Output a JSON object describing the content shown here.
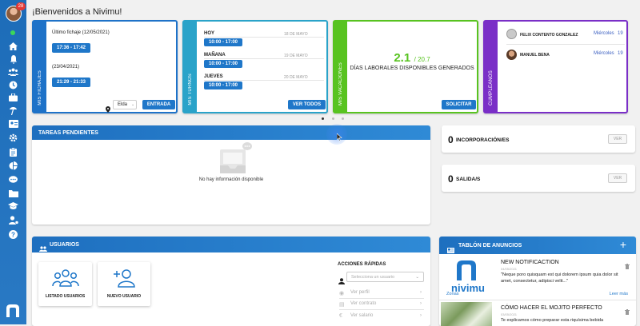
{
  "user": {
    "badge_count": "28"
  },
  "header": {
    "title": "¡Bienvenidos a Nivimu!"
  },
  "fichajes": {
    "tab_label": "MIS FICHAJES",
    "last_label": "Último fichaje (12/05/2021)",
    "last_range": "17:36 - 17:42",
    "prev_label": "(23/04/2021)",
    "prev_range": "21:29 - 21:33",
    "location": "Elda",
    "button": "ENTRADA"
  },
  "turnos": {
    "tab_label": "MIS TURNOS",
    "days": [
      {
        "label": "HOY",
        "date": "18 DE MAYO",
        "range": "10:00 - 17:00"
      },
      {
        "label": "MAÑANA",
        "date": "19 DE MAYO",
        "range": "10:00 - 17:00"
      },
      {
        "label": "JUEVES",
        "date": "20 DE MAYO",
        "range": "10:00 - 17:00"
      }
    ],
    "button": "VER TODOS"
  },
  "vacaciones": {
    "tab_label": "MIS VACACIONES",
    "value": "2.1",
    "total": "/ 20.7",
    "caption": "DÍAS LABORALES DISPONIBLES GENERADOS",
    "button": "SOLICITAR"
  },
  "cumpleanos": {
    "tab_label": "CUMPLEAÑOS",
    "people": [
      {
        "name": "FELIX CONTENTO GONZALEZ",
        "day": "Miércoles",
        "num": "19"
      },
      {
        "name": "MANUEL BENA",
        "day": "Miércoles",
        "num": "19"
      }
    ]
  },
  "tareas": {
    "title": "TAREAS PENDIENTES",
    "empty": "No hay información disponible"
  },
  "incorporacion": {
    "count": "0",
    "label": "INCORPORACIÓN/ES",
    "button": "VER"
  },
  "salida": {
    "count": "0",
    "label": "SALIDA/S",
    "button": "VER"
  },
  "usuarios": {
    "title": "USUARIOS",
    "tiles": [
      {
        "label": "LISTADO USUARIOS"
      },
      {
        "label": "NUEVO USUARIO"
      }
    ],
    "quick_title": "ACCIONES RÁPIDAS",
    "select_placeholder": "Selecciona un usuario",
    "links": [
      {
        "label": "Ver perfil"
      },
      {
        "label": "Ver contrato"
      },
      {
        "label": "Ver salario"
      }
    ]
  },
  "tablon": {
    "title": "TABLÓN DE ANUNCIOS",
    "posts": [
      {
        "logo": "nivimu",
        "title": "NEW NOTIFICACTION",
        "date": "04/05/2021",
        "excerpt": "\"Neque poro quisquam est qui dolorem ipsum quia dolor sit amet, consectetur, adipisci velit...\"",
        "tag": "Zonas",
        "more": "Leer más"
      },
      {
        "title": "CÓMO HACER EL MOJITO PERFECTO",
        "date": "03/05/2021",
        "excerpt": "Te explicamos cómo preparar esta riquísima bebida"
      }
    ]
  },
  "colors": {
    "primary": "#1f77c9",
    "fichajes": "#1e72c8",
    "turnos": "#2aa3c9",
    "vacaciones": "#58c320",
    "cumpleanos": "#7a2fc7"
  }
}
